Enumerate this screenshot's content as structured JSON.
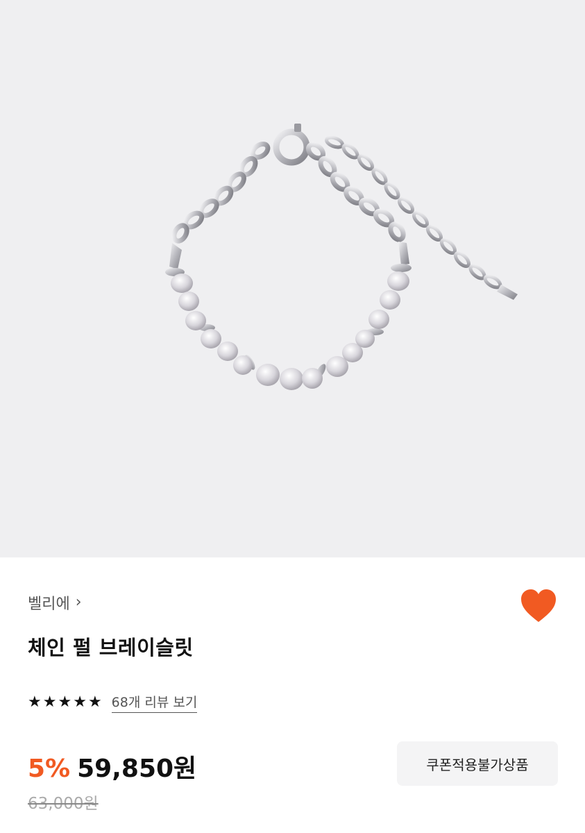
{
  "product": {
    "brand": "벨리에",
    "brand_chevron": "›",
    "title": "체인 펄 브레이슬릿",
    "rating": 5,
    "review_link": "68개 리뷰 보기",
    "discount": "5%",
    "price": "59,850원",
    "original_price": "63,000원",
    "coupon_badge": "쿠폰적용불가상품",
    "wishlisted": true
  },
  "icons": {
    "brand_chevron": "chevron-right-icon",
    "wishlist": "heart-icon",
    "star": "star-icon"
  },
  "colors": {
    "accent": "#f15a22",
    "hero_bg": "#efeff1",
    "text": "#111111",
    "muted": "#555555"
  }
}
